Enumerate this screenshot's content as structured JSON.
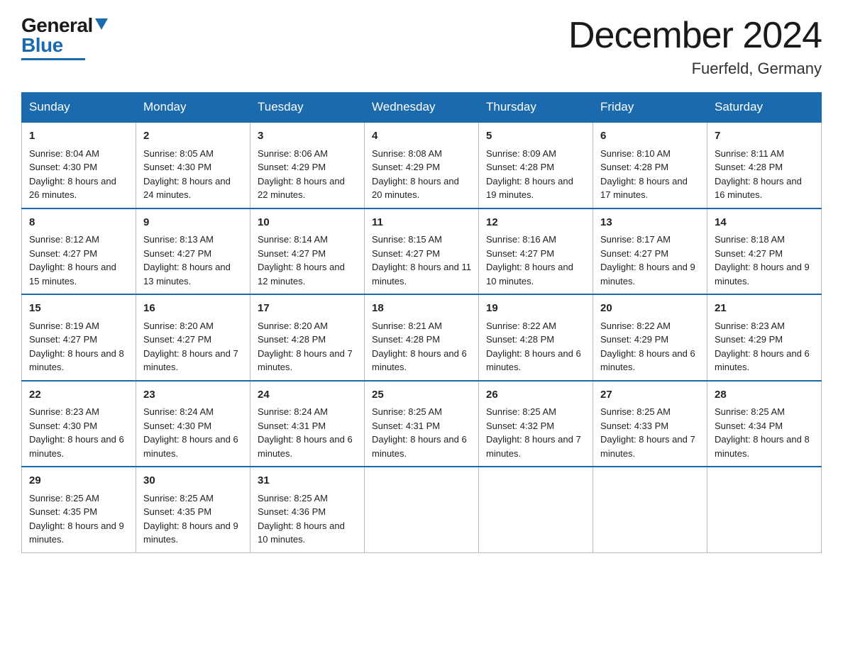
{
  "header": {
    "logo_general": "General",
    "logo_blue": "Blue",
    "month_title": "December 2024",
    "location": "Fuerfeld, Germany"
  },
  "weekdays": [
    "Sunday",
    "Monday",
    "Tuesday",
    "Wednesday",
    "Thursday",
    "Friday",
    "Saturday"
  ],
  "weeks": [
    [
      {
        "day": "1",
        "sunrise": "8:04 AM",
        "sunset": "4:30 PM",
        "daylight": "8 hours and 26 minutes."
      },
      {
        "day": "2",
        "sunrise": "8:05 AM",
        "sunset": "4:30 PM",
        "daylight": "8 hours and 24 minutes."
      },
      {
        "day": "3",
        "sunrise": "8:06 AM",
        "sunset": "4:29 PM",
        "daylight": "8 hours and 22 minutes."
      },
      {
        "day": "4",
        "sunrise": "8:08 AM",
        "sunset": "4:29 PM",
        "daylight": "8 hours and 20 minutes."
      },
      {
        "day": "5",
        "sunrise": "8:09 AM",
        "sunset": "4:28 PM",
        "daylight": "8 hours and 19 minutes."
      },
      {
        "day": "6",
        "sunrise": "8:10 AM",
        "sunset": "4:28 PM",
        "daylight": "8 hours and 17 minutes."
      },
      {
        "day": "7",
        "sunrise": "8:11 AM",
        "sunset": "4:28 PM",
        "daylight": "8 hours and 16 minutes."
      }
    ],
    [
      {
        "day": "8",
        "sunrise": "8:12 AM",
        "sunset": "4:27 PM",
        "daylight": "8 hours and 15 minutes."
      },
      {
        "day": "9",
        "sunrise": "8:13 AM",
        "sunset": "4:27 PM",
        "daylight": "8 hours and 13 minutes."
      },
      {
        "day": "10",
        "sunrise": "8:14 AM",
        "sunset": "4:27 PM",
        "daylight": "8 hours and 12 minutes."
      },
      {
        "day": "11",
        "sunrise": "8:15 AM",
        "sunset": "4:27 PM",
        "daylight": "8 hours and 11 minutes."
      },
      {
        "day": "12",
        "sunrise": "8:16 AM",
        "sunset": "4:27 PM",
        "daylight": "8 hours and 10 minutes."
      },
      {
        "day": "13",
        "sunrise": "8:17 AM",
        "sunset": "4:27 PM",
        "daylight": "8 hours and 9 minutes."
      },
      {
        "day": "14",
        "sunrise": "8:18 AM",
        "sunset": "4:27 PM",
        "daylight": "8 hours and 9 minutes."
      }
    ],
    [
      {
        "day": "15",
        "sunrise": "8:19 AM",
        "sunset": "4:27 PM",
        "daylight": "8 hours and 8 minutes."
      },
      {
        "day": "16",
        "sunrise": "8:20 AM",
        "sunset": "4:27 PM",
        "daylight": "8 hours and 7 minutes."
      },
      {
        "day": "17",
        "sunrise": "8:20 AM",
        "sunset": "4:28 PM",
        "daylight": "8 hours and 7 minutes."
      },
      {
        "day": "18",
        "sunrise": "8:21 AM",
        "sunset": "4:28 PM",
        "daylight": "8 hours and 6 minutes."
      },
      {
        "day": "19",
        "sunrise": "8:22 AM",
        "sunset": "4:28 PM",
        "daylight": "8 hours and 6 minutes."
      },
      {
        "day": "20",
        "sunrise": "8:22 AM",
        "sunset": "4:29 PM",
        "daylight": "8 hours and 6 minutes."
      },
      {
        "day": "21",
        "sunrise": "8:23 AM",
        "sunset": "4:29 PM",
        "daylight": "8 hours and 6 minutes."
      }
    ],
    [
      {
        "day": "22",
        "sunrise": "8:23 AM",
        "sunset": "4:30 PM",
        "daylight": "8 hours and 6 minutes."
      },
      {
        "day": "23",
        "sunrise": "8:24 AM",
        "sunset": "4:30 PM",
        "daylight": "8 hours and 6 minutes."
      },
      {
        "day": "24",
        "sunrise": "8:24 AM",
        "sunset": "4:31 PM",
        "daylight": "8 hours and 6 minutes."
      },
      {
        "day": "25",
        "sunrise": "8:25 AM",
        "sunset": "4:31 PM",
        "daylight": "8 hours and 6 minutes."
      },
      {
        "day": "26",
        "sunrise": "8:25 AM",
        "sunset": "4:32 PM",
        "daylight": "8 hours and 7 minutes."
      },
      {
        "day": "27",
        "sunrise": "8:25 AM",
        "sunset": "4:33 PM",
        "daylight": "8 hours and 7 minutes."
      },
      {
        "day": "28",
        "sunrise": "8:25 AM",
        "sunset": "4:34 PM",
        "daylight": "8 hours and 8 minutes."
      }
    ],
    [
      {
        "day": "29",
        "sunrise": "8:25 AM",
        "sunset": "4:35 PM",
        "daylight": "8 hours and 9 minutes."
      },
      {
        "day": "30",
        "sunrise": "8:25 AM",
        "sunset": "4:35 PM",
        "daylight": "8 hours and 9 minutes."
      },
      {
        "day": "31",
        "sunrise": "8:25 AM",
        "sunset": "4:36 PM",
        "daylight": "8 hours and 10 minutes."
      },
      null,
      null,
      null,
      null
    ]
  ]
}
